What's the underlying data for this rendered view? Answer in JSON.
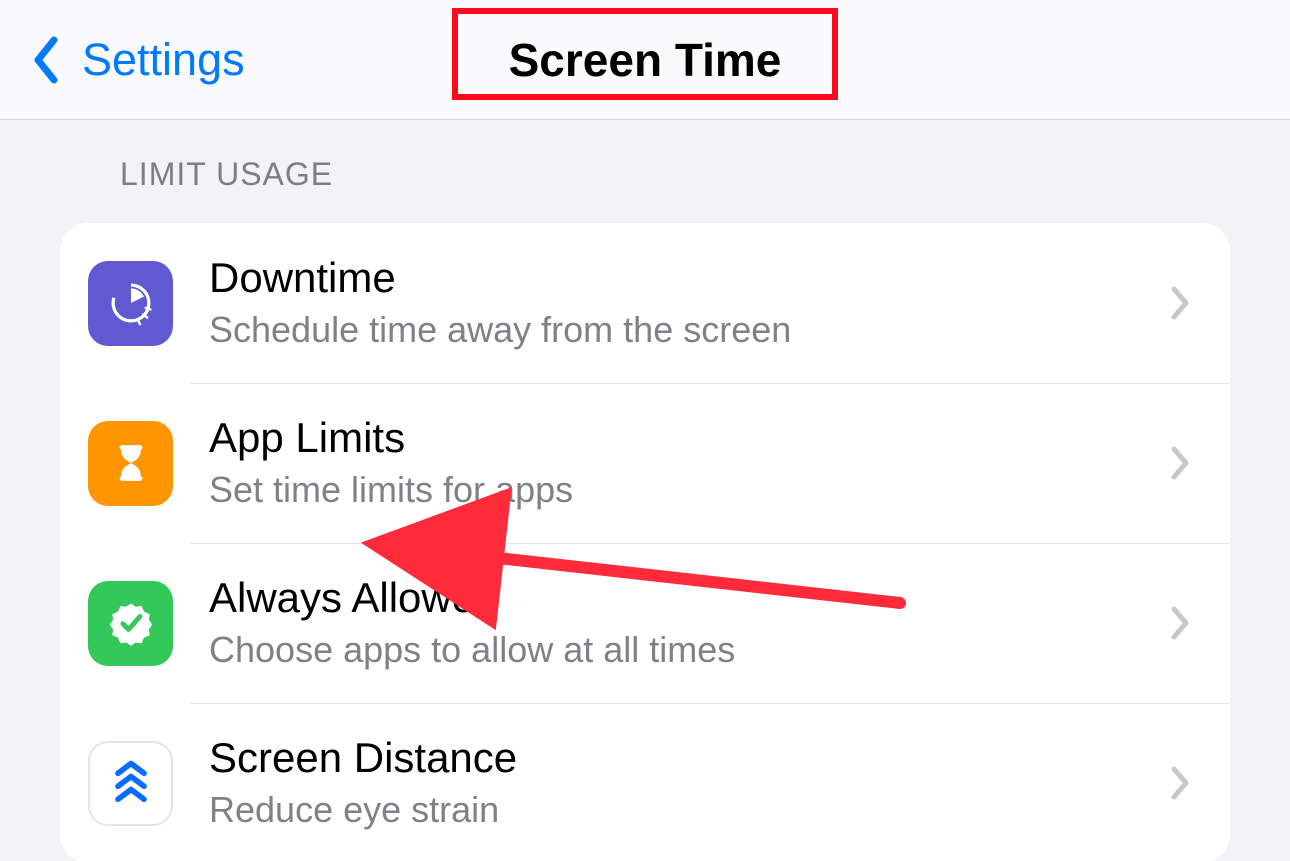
{
  "nav": {
    "back_label": "Settings",
    "title": "Screen Time"
  },
  "section": {
    "header": "LIMIT USAGE",
    "rows": [
      {
        "icon_name": "downtime-icon",
        "title": "Downtime",
        "subtitle": "Schedule time away from the screen"
      },
      {
        "icon_name": "hourglass-icon",
        "title": "App Limits",
        "subtitle": "Set time limits for apps"
      },
      {
        "icon_name": "checkmark-seal-icon",
        "title": "Always Allowed",
        "subtitle": "Choose apps to allow at all times"
      },
      {
        "icon_name": "screen-distance-icon",
        "title": "Screen Distance",
        "subtitle": "Reduce eye strain"
      }
    ]
  },
  "annotation": {
    "title_highlight_color": "#ff0a1a",
    "arrow_color": "#ff2b3a"
  }
}
